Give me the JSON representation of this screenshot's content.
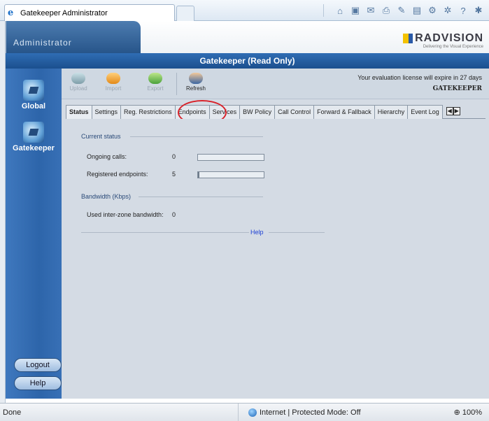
{
  "browser": {
    "tab_title": "Gatekeeper Administrator",
    "tools": [
      "home-icon",
      "feeds-icon",
      "mail-icon",
      "print-icon",
      "favorites-icon",
      "page-icon",
      "safety-icon",
      "tools-icon",
      "help-icon",
      "bug-icon"
    ],
    "status_text": "Done",
    "zone_text": "Internet | Protected Mode: Off",
    "zoom_text": "100%"
  },
  "header": {
    "app_title": "Administrator",
    "logo_text": "RADVISION",
    "logo_sub": "Delivering the Visual Experience"
  },
  "title_band": "Gatekeeper (Read Only)",
  "nav": {
    "items": [
      {
        "label": "Global"
      },
      {
        "label": "Gatekeeper"
      }
    ],
    "buttons": [
      {
        "label": "Logout"
      },
      {
        "label": "Help"
      }
    ]
  },
  "toolbar": {
    "buttons": [
      {
        "label": "Upload",
        "enabled": false
      },
      {
        "label": "Import",
        "enabled": false
      },
      {
        "label": "Export",
        "enabled": false
      },
      {
        "label": "Refresh",
        "enabled": true
      }
    ],
    "license_text": "Your evaluation license will expire in 27 days",
    "license_name": "GATEKEEPER"
  },
  "tabs": [
    {
      "label": "Status",
      "active": true
    },
    {
      "label": "Settings",
      "active": false
    },
    {
      "label": "Reg. Restrictions",
      "active": false
    },
    {
      "label": "Endpoints",
      "active": false
    },
    {
      "label": "Services",
      "active": false
    },
    {
      "label": "BW Policy",
      "active": false
    },
    {
      "label": "Call Control",
      "active": false
    },
    {
      "label": "Forward & Fallback",
      "active": false
    },
    {
      "label": "Hierarchy",
      "active": false
    },
    {
      "label": "Event Log",
      "active": false
    }
  ],
  "status": {
    "current_status_heading": "Current status",
    "ongoing_calls_label": "Ongoing calls:",
    "ongoing_calls_value": "0",
    "ongoing_calls_fill": 0,
    "registered_endpoints_label": "Registered endpoints:",
    "registered_endpoints_value": "5",
    "registered_endpoints_fill": 0.02,
    "bandwidth_heading": "Bandwidth (Kbps)",
    "inter_zone_label": "Used inter-zone bandwidth:",
    "inter_zone_value": "0",
    "help_link": "Help"
  },
  "colors": {
    "title_band": "#1b4f8e",
    "highlight_ring": "#d8222a",
    "help_link": "#1c3fd4"
  }
}
